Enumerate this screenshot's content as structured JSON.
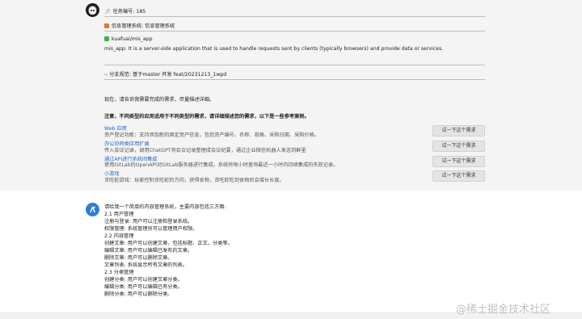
{
  "header": {
    "task_id": "任务编号: 185",
    "system_name": "信息管理系统: 信息管理系统",
    "repo": "kuafuai/mis_app",
    "description": "mis_app: It is a server-side application that is used to handle requests sent by clients (typically browsers) and provide data or services.",
    "branch": "分支规范: 基于master 开发 feat/20231213_1wpd"
  },
  "prompt": {
    "ask": "现在，请告诉我需要完成的需求，尽量描述详细。",
    "note": "注意，不同类型的应用适用于不同类型的需求，请详细描述您的需求，以下是一些参考案例。"
  },
  "examples": [
    {
      "title": "Web 应用",
      "desc": "资产登记功能：支持添加新的固定资产信息，包括资产编号、名称、规格、采购日期、采购价格。",
      "button": "试一下这个需求"
    },
    {
      "title": "办公协同类应用扩展",
      "desc": "传入会议记录，调用ChatGPT将会议记录整理成会议纪要，通过企业微信机器人发送到群里",
      "button": "试一下这个需求"
    },
    {
      "title": "通过API进行系统间集成",
      "desc": "使用GitLab的OpenAPI对GitLab服务器进行集成。系统将每小时查询最近一小时内持续集成的失败记录。",
      "button": "试一下这个需求"
    },
    {
      "title": "小游戏",
      "desc": "贪吃蛇游戏：玩家控制贪吃蛇的方向，获得食物，贪吃蛇吃到食物后会增长长度。",
      "button": "试一下这个需求"
    }
  ],
  "reply": {
    "lines": [
      "请给我一个简单的内容管理系统，主要内容包括三方面:",
      "2.1 用户管理",
      "注册与登录: 用户可以注册和登录系统。",
      "权限管理: 系统管理员可以管理用户权限。",
      "2.2 内容管理",
      "创建文章: 用户可以创建文章，包括标题、正文、分类等。",
      "编辑文章: 用户可以编辑已发布的文章。",
      "删除文章: 用户可以删除文章。",
      "文章列表: 系统显示所有文章的列表。",
      "2.3 分类管理",
      "创建分类: 用户可以创建文章分类。",
      "编辑分类: 用户可以编辑已有分类。",
      "删除分类: 用户可以删除分类。"
    ]
  },
  "watermark": "@稀土掘金技术社区",
  "colors": {
    "accent": "#2467c8",
    "pin": "#3db24a",
    "system_icon": "#e07a2f",
    "repo_icon": "#3db24a",
    "branch_icon": "#7c7c7c"
  }
}
